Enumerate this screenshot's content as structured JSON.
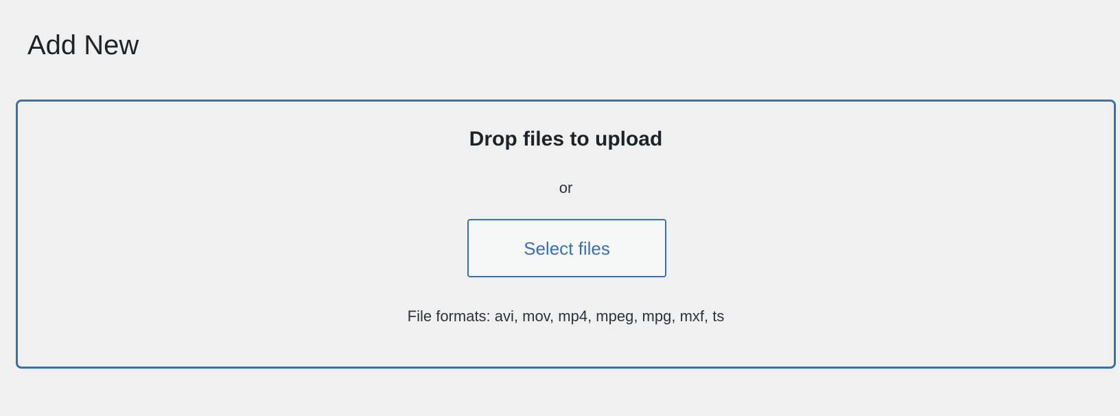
{
  "header": {
    "title": "Add New"
  },
  "upload": {
    "drop_title": "Drop files to upload",
    "or_text": "or",
    "select_button_label": "Select files",
    "formats_text": "File formats: avi, mov, mp4, mpeg, mpg, mxf, ts"
  },
  "colors": {
    "background": "#f0f0f1",
    "accent": "#3a6fae",
    "text": "#1d2327"
  }
}
